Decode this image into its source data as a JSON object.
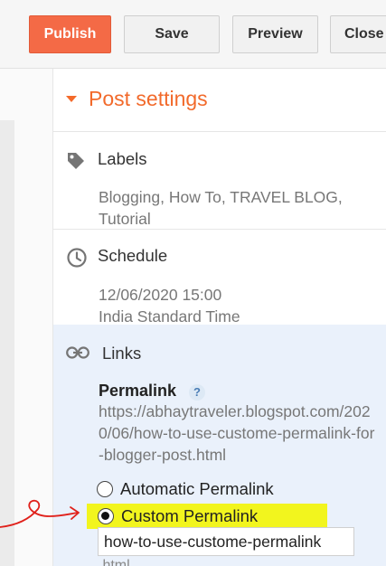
{
  "toolbar": {
    "publish": "Publish",
    "save": "Save",
    "preview": "Preview",
    "close": "Close"
  },
  "post_settings": {
    "title": "Post settings",
    "labels": {
      "title": "Labels",
      "value": "Blogging, How To, TRAVEL BLOG, Tutorial",
      "icon": "tag-icon"
    },
    "schedule": {
      "title": "Schedule",
      "date": "12/06/2020 15:00",
      "timezone": "India Standard Time",
      "icon": "clock-icon"
    },
    "links": {
      "title": "Links",
      "icon": "link-icon",
      "permalink_label": "Permalink",
      "help": "?",
      "permalink_url": "https://abhaytraveler.blogspot.com/2020/06/how-to-use-custome-permalink-for-blogger-post.html",
      "options": [
        "Automatic Permalink",
        "Custom Permalink"
      ],
      "selected": "Custom Permalink",
      "custom_value": "how-to-use-custome-permalink",
      "suffix": ".html"
    }
  },
  "colors": {
    "accent": "#f46a46",
    "title_orange": "#f26a2b",
    "highlight": "#f2f51e",
    "links_bg": "#eaf1fb",
    "annotation": "#e0201a"
  }
}
